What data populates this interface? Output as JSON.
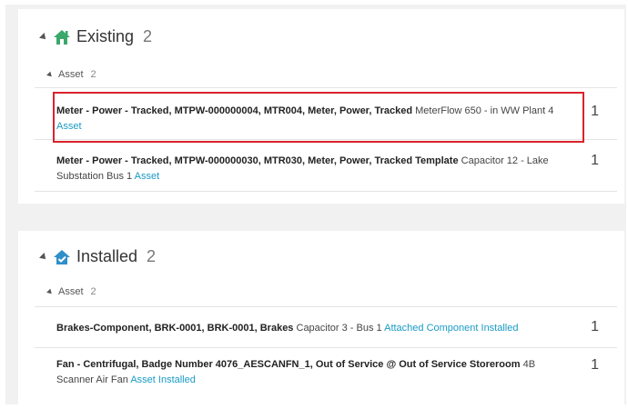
{
  "existing": {
    "title": "Existing",
    "count": "2",
    "group": {
      "label": "Asset",
      "count": "2"
    },
    "rows": [
      {
        "bold": "Meter - Power - Tracked, MTPW-000000004, MTR004, Meter, Power, Tracked",
        "detail": " MeterFlow 650 - in WW Plant 4 ",
        "link": "Asset",
        "count": "1"
      },
      {
        "bold": "Meter - Power - Tracked, MTPW-000000030, MTR030, Meter, Power, Tracked Template",
        "detail": " Capacitor 12 - Lake Substation Bus 1 ",
        "link": "Asset",
        "count": "1"
      }
    ]
  },
  "installed": {
    "title": "Installed",
    "count": "2",
    "group": {
      "label": "Asset",
      "count": "2"
    },
    "rows": [
      {
        "bold": "Brakes-Component, BRK-0001, BRK-0001, Brakes",
        "detail": " Capacitor 3 - Bus 1 ",
        "link": "Attached Component Installed",
        "count": "1"
      },
      {
        "bold": "Fan - Centrifugal, Badge Number 4076_AESCANFN_1, Out of Service @ Out of Service Storeroom",
        "detail": " 4B Scanner Air Fan ",
        "link": "Asset Installed",
        "count": "1"
      }
    ]
  },
  "colors": {
    "icon": "#3aa86b",
    "link": "#1a9bc4",
    "highlight": "#d9232d"
  },
  "icons": {
    "existing": "house-icon",
    "installed": "house-check-icon"
  }
}
